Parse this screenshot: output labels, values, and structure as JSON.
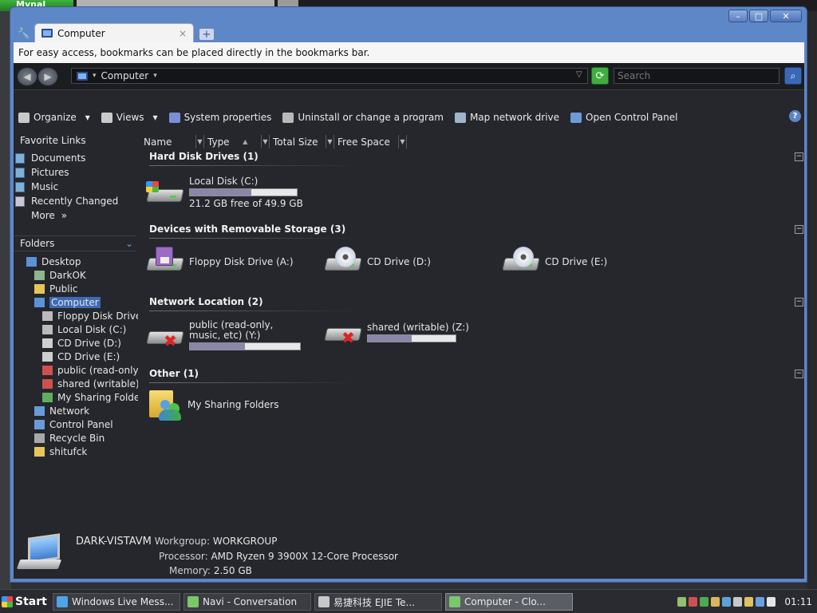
{
  "host": {
    "top_app": "Mynal"
  },
  "browser": {
    "tab_title": "Computer",
    "tab_close": "×",
    "new_tab": "+",
    "bookmarks_message": "For easy access, bookmarks can be placed directly in the bookmarks bar.",
    "window_buttons": {
      "minimize": "–",
      "maximize": "□",
      "close": "✕"
    }
  },
  "explorer": {
    "address": {
      "location": "Computer"
    },
    "search": {
      "placeholder": "Search"
    },
    "toolbar": [
      {
        "label": "Organize",
        "icon": "organize-icon",
        "color": "#c9c9c9",
        "dropdown": true
      },
      {
        "label": "Views",
        "icon": "views-icon",
        "color": "#c9c9c9",
        "dropdown": true
      },
      {
        "label": "System properties",
        "icon": "system-properties-icon",
        "color": "#7a8fd8"
      },
      {
        "label": "Uninstall or change a program",
        "icon": "uninstall-icon",
        "color": "#b9b9b9"
      },
      {
        "label": "Map network drive",
        "icon": "map-drive-icon",
        "color": "#9fb6c9"
      },
      {
        "label": "Open Control Panel",
        "icon": "control-panel-icon",
        "color": "#6f9ad8"
      }
    ],
    "help": "?",
    "favorite_links": {
      "title": "Favorite Links",
      "items": [
        "Documents",
        "Pictures",
        "Music",
        "Recently Changed"
      ],
      "more": "More",
      "more_glyph": "»"
    },
    "folders": {
      "title": "Folders",
      "tree": [
        {
          "label": "Desktop",
          "level": 0,
          "icon": "desktop-icon",
          "color": "#5b92d8"
        },
        {
          "label": "DarkOK",
          "level": 1,
          "icon": "user-folder-icon",
          "color": "#8fb48f"
        },
        {
          "label": "Public",
          "level": 1,
          "icon": "folder-icon",
          "color": "#e7c55a"
        },
        {
          "label": "Computer",
          "level": 1,
          "icon": "computer-icon",
          "color": "#5b92d8",
          "selected": true
        },
        {
          "label": "Floppy Disk Drive",
          "level": 2,
          "icon": "floppy-icon",
          "color": "#bbbbbb"
        },
        {
          "label": "Local Disk (C:)",
          "level": 2,
          "icon": "disk-icon",
          "color": "#bbbbbb"
        },
        {
          "label": "CD Drive (D:)",
          "level": 2,
          "icon": "cd-icon",
          "color": "#cfcfcf"
        },
        {
          "label": "CD Drive (E:)",
          "level": 2,
          "icon": "cd-icon",
          "color": "#cfcfcf"
        },
        {
          "label": "public (read-only,",
          "level": 2,
          "icon": "network-drive-icon",
          "color": "#d05050"
        },
        {
          "label": "shared (writable) (",
          "level": 2,
          "icon": "network-drive-icon",
          "color": "#d05050"
        },
        {
          "label": "My Sharing Folders",
          "level": 2,
          "icon": "sharing-folder-icon",
          "color": "#5fae5f"
        },
        {
          "label": "Network",
          "level": 1,
          "icon": "network-icon",
          "color": "#6a9ad8"
        },
        {
          "label": "Control Panel",
          "level": 1,
          "icon": "control-panel-icon",
          "color": "#6a9ad8"
        },
        {
          "label": "Recycle Bin",
          "level": 1,
          "icon": "recycle-bin-icon",
          "color": "#a8a8a8"
        },
        {
          "label": "shitufck",
          "level": 1,
          "icon": "folder-icon",
          "color": "#e7c55a"
        }
      ]
    },
    "columns": [
      "Name",
      "Type",
      "Total Size",
      "Free Space"
    ],
    "groups": {
      "hdd": {
        "title": "Hard Disk Drives (1)",
        "items": [
          {
            "name": "Local Disk (C:)",
            "free_text": "21.2 GB free of 49.9 GB",
            "used_fraction": 0.575
          }
        ]
      },
      "removable": {
        "title": "Devices with Removable Storage (3)",
        "items": [
          {
            "name": "Floppy Disk Drive (A:)"
          },
          {
            "name": "CD Drive (D:)"
          },
          {
            "name": "CD Drive (E:)"
          }
        ]
      },
      "network": {
        "title": "Network Location (2)",
        "items": [
          {
            "name": "public (read-only, music, etc) (Y:)",
            "used_fraction": 0.5
          },
          {
            "name": "shared (writable) (Z:)",
            "used_fraction": 0.5
          }
        ]
      },
      "other": {
        "title": "Other (1)",
        "items": [
          {
            "name": "My Sharing Folders"
          }
        ]
      },
      "collapse_glyph": "−"
    },
    "details": {
      "computer_name": "DARK-VISTAVM",
      "workgroup_label": "Workgroup:",
      "workgroup": "WORKGROUP",
      "processor_label": "Processor:",
      "processor": "AMD Ryzen 9 3900X 12-Core Processor",
      "memory_label": "Memory:",
      "memory": "2.50 GB"
    }
  },
  "taskbar": {
    "start": "Start",
    "tasks": [
      {
        "label": "Windows Live Mess...",
        "icon": "messenger-icon",
        "color": "#4fa4e8"
      },
      {
        "label": "Navi - Conversation",
        "icon": "conversation-icon",
        "color": "#7bc86b"
      },
      {
        "label": "易捷科技 EJIE Te...",
        "icon": "browser-icon",
        "color": "#c8c8c8"
      },
      {
        "label": "Computer - Clo...",
        "icon": "browser-icon",
        "color": "#7bc86b",
        "active": true
      }
    ],
    "tray_icons": [
      "network-tray-icon",
      "shield-tray-icon",
      "security-tray-icon",
      "user-tray-icon",
      "app-tray-icon",
      "app2-tray-icon",
      "app3-tray-icon",
      "display-tray-icon",
      "volume-tray-icon"
    ],
    "tray_colors": [
      "#8fbf6f",
      "#d05050",
      "#4faa4f",
      "#d8b85a",
      "#5fa0d8",
      "#c8c8c8",
      "#e0c060",
      "#6aa0e0",
      "#e6e6e6"
    ],
    "clock": "01:11"
  }
}
